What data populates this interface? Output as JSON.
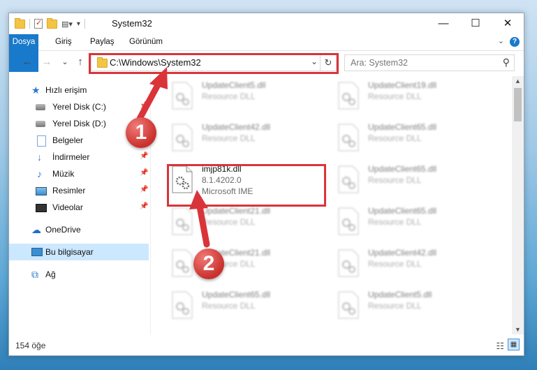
{
  "window": {
    "title": "System32",
    "controls": {
      "minimize": "—",
      "maximize": "☐",
      "close": "✕"
    }
  },
  "ribbon": {
    "tabs": [
      "Dosya",
      "Giriş",
      "Paylaş",
      "Görünüm"
    ],
    "help": "?"
  },
  "nav": {
    "back": "←",
    "forward": "→",
    "recent": "⌄",
    "up": "↑",
    "address": "C:\\Windows\\System32",
    "search_placeholder": "Ara: System32"
  },
  "sidebar": {
    "items": [
      {
        "label": "Hızlı erişim",
        "icon": "star-icon"
      },
      {
        "label": "Yerel Disk (C:)",
        "icon": "disk-icon",
        "pinned": true
      },
      {
        "label": "Yerel Disk (D:)",
        "icon": "disk-icon"
      },
      {
        "label": "Belgeler",
        "icon": "documents-icon"
      },
      {
        "label": "İndirmeler",
        "icon": "download-icon",
        "pinned": true
      },
      {
        "label": "Müzik",
        "icon": "music-icon",
        "pinned": true
      },
      {
        "label": "Resimler",
        "icon": "pictures-icon",
        "pinned": true
      },
      {
        "label": "Videolar",
        "icon": "videos-icon",
        "pinned": true
      },
      {
        "label": "OneDrive",
        "icon": "cloud-icon"
      },
      {
        "label": "Bu bilgisayar",
        "icon": "computer-icon",
        "selected": true
      },
      {
        "label": "Ağ",
        "icon": "network-icon"
      }
    ]
  },
  "files": {
    "left": [
      {
        "name": "UpdateClient5.dll",
        "type": "Resource DLL"
      },
      {
        "name": "UpdateClient42.dll",
        "type": "Resource DLL"
      },
      {
        "name": "imjp81k.dll",
        "type": "8.1.4202.0",
        "desc": "Microsoft IME"
      },
      {
        "name": "UpdateClient21.dll",
        "type": "Resource DLL"
      },
      {
        "name": "UpdateClient21.dll",
        "type": "Resource DLL"
      },
      {
        "name": "UpdateClient65.dll",
        "type": "Resource DLL"
      }
    ],
    "right": [
      {
        "name": "UpdateClient19.dll",
        "type": "Resource DLL"
      },
      {
        "name": "UpdateClient65.dll",
        "type": "Resource DLL"
      },
      {
        "name": "UpdateClient65.dll",
        "type": "Resource DLL"
      },
      {
        "name": "UpdateClient65.dll",
        "type": "Resource DLL"
      },
      {
        "name": "UpdateClient42.dll",
        "type": "Resource DLL"
      },
      {
        "name": "UpdateClient5.dll",
        "type": "Resource DLL"
      }
    ]
  },
  "status": {
    "count": "154 öğe"
  },
  "annotations": {
    "step1": "1",
    "step2": "2",
    "color": "#d9343a"
  }
}
